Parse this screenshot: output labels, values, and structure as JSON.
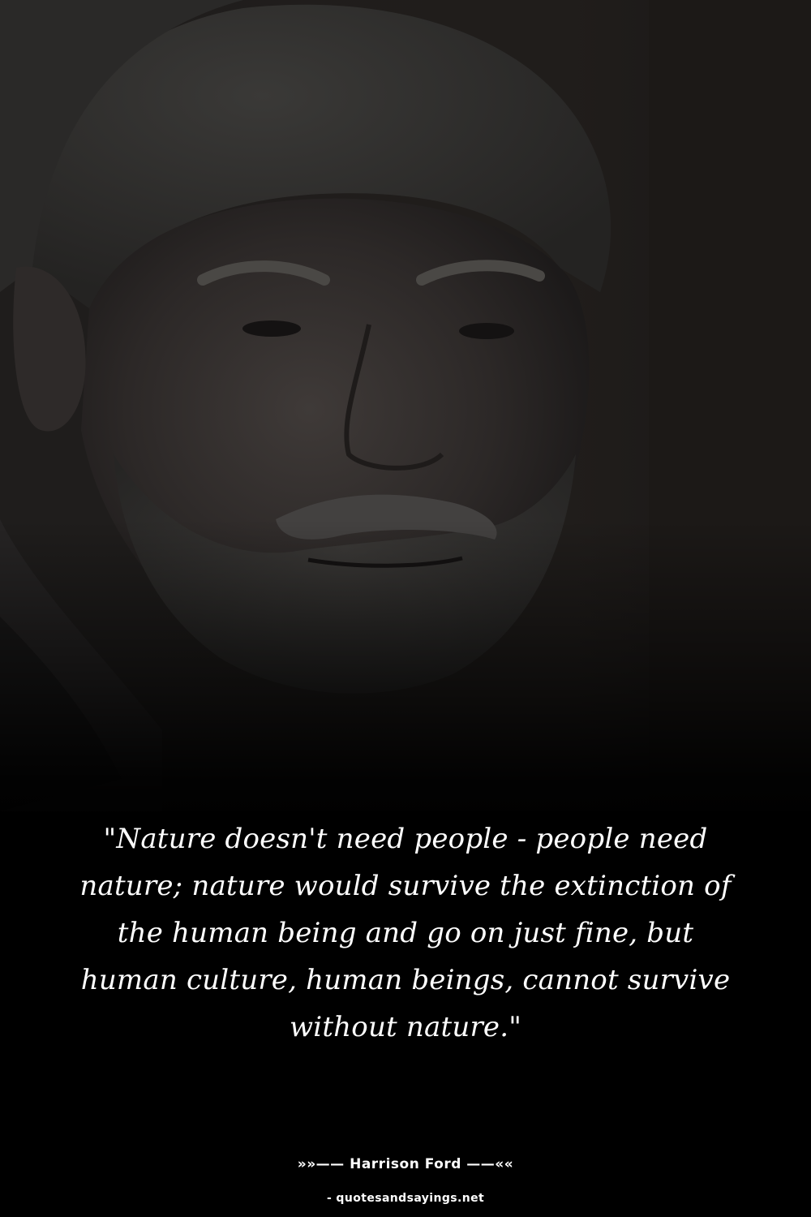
{
  "quote": {
    "text": "\"Nature doesn't need people - people need nature; nature would survive the extinction of the human being and go on just fine, but human culture, human beings, cannot survive without nature.\""
  },
  "attribution": {
    "text": "»»—— Harrison Ford ——««"
  },
  "source": {
    "text": "- quotesandsayings.net"
  },
  "colors": {
    "background": "#000000",
    "text": "#ffffff"
  }
}
